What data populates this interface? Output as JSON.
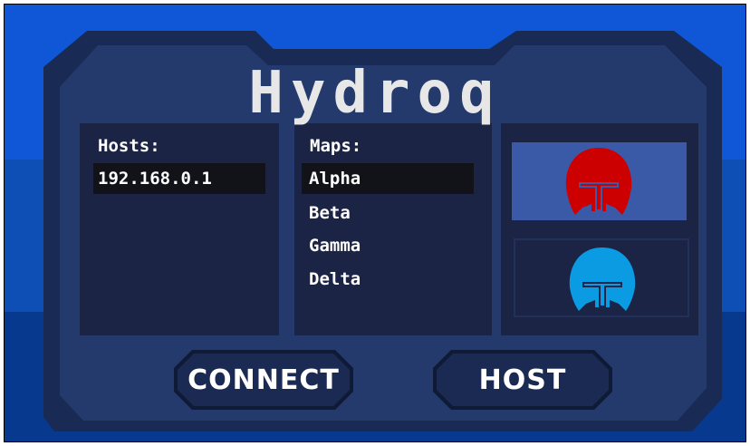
{
  "game": {
    "title": "Hydroq"
  },
  "hosts": {
    "label": "Hosts:",
    "items": [
      "192.168.0.1"
    ],
    "selected_index": 0
  },
  "maps": {
    "label": "Maps:",
    "items": [
      "Alpha",
      "Beta",
      "Gamma",
      "Delta"
    ],
    "selected_index": 0
  },
  "teams": {
    "items": [
      {
        "team": "red",
        "color": "#cc0000",
        "selected": true
      },
      {
        "team": "blue",
        "color": "#0b9be3",
        "selected": false
      }
    ]
  },
  "buttons": {
    "connect_label": "CONNECT",
    "host_label": "HOST"
  },
  "colors": {
    "background_top": "#0f57d6",
    "background_mid": "#0d4fb5",
    "background_bottom": "#073a8e",
    "frame_outer": "#192a54",
    "frame_inner": "#243a6c",
    "panel": "#1b2444",
    "selection": "#111319",
    "team_selected_bg": "#3a5aa8"
  }
}
